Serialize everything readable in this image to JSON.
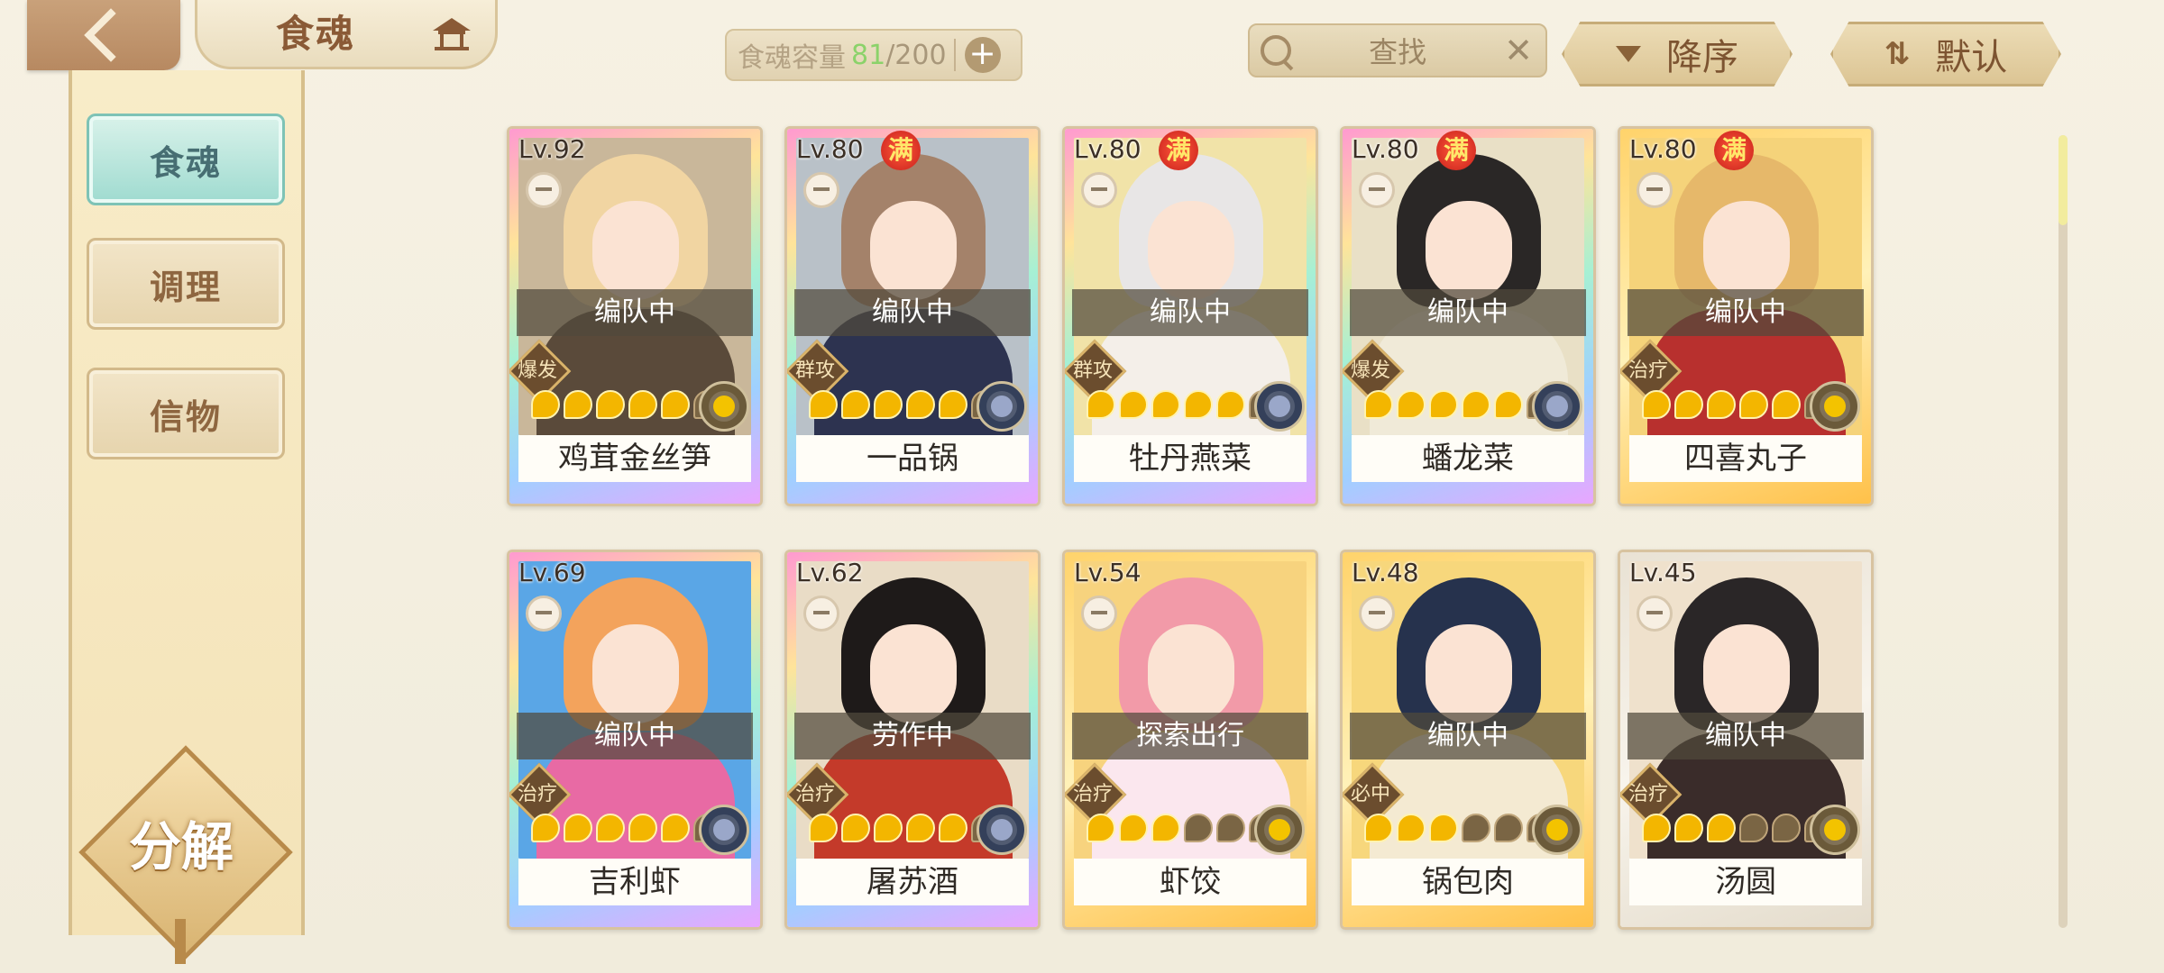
{
  "header": {
    "title": "食魂",
    "capacity_label": "食魂容量",
    "capacity_current": "81",
    "capacity_max": "/200",
    "add_label": "+",
    "search_label": "查找",
    "clear_label": "✕",
    "sort_order_label": "降序",
    "sort_default_label": "默认"
  },
  "sidebar": {
    "items": [
      {
        "label": "食魂",
        "active": true
      },
      {
        "label": "调理",
        "active": false
      },
      {
        "label": "信物",
        "active": false
      }
    ],
    "decompose_label": "分解"
  },
  "colors": {
    "accent_teal": "#9fdbd0",
    "capacity_green": "#8bd26a",
    "brown_text": "#7d5431"
  },
  "cards": [
    {
      "level": "Lv.92",
      "full": "",
      "status": "编队中",
      "role": "爆发",
      "stars": 5,
      "name": "鸡茸金丝笋"
    },
    {
      "level": "Lv.80",
      "full": "满",
      "status": "编队中",
      "role": "群攻",
      "stars": 5,
      "name": "一品锅"
    },
    {
      "level": "Lv.80",
      "full": "满",
      "status": "编队中",
      "role": "群攻",
      "stars": 5,
      "name": "牡丹燕菜"
    },
    {
      "level": "Lv.80",
      "full": "满",
      "status": "编队中",
      "role": "爆发",
      "stars": 5,
      "name": "蟠龙菜"
    },
    {
      "level": "Lv.80",
      "full": "满",
      "status": "编队中",
      "role": "治疗",
      "stars": 5,
      "name": "四喜丸子"
    },
    {
      "level": "Lv.69",
      "full": "",
      "status": "编队中",
      "role": "治疗",
      "stars": 5,
      "name": "吉利虾"
    },
    {
      "level": "Lv.62",
      "full": "",
      "status": "劳作中",
      "role": "治疗",
      "stars": 5,
      "name": "屠苏酒"
    },
    {
      "level": "Lv.54",
      "full": "",
      "status": "探索出行",
      "role": "治疗",
      "stars": 3,
      "name": "虾饺"
    },
    {
      "level": "Lv.48",
      "full": "",
      "status": "编队中",
      "role": "必中",
      "stars": 3,
      "name": "锅包肉"
    },
    {
      "level": "Lv.45",
      "full": "",
      "status": "编队中",
      "role": "治疗",
      "stars": 3,
      "name": "汤圆"
    }
  ]
}
